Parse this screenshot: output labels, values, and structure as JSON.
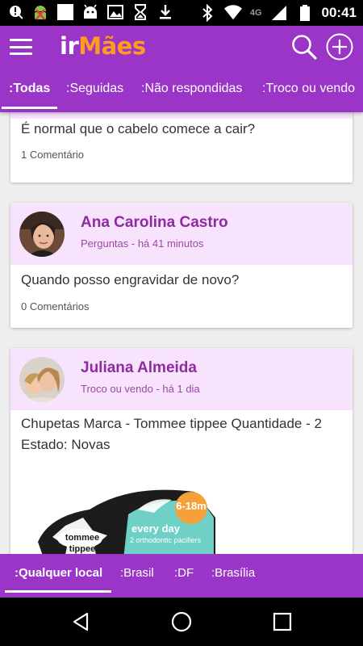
{
  "status_bar": {
    "time": "00:41",
    "network": "4G",
    "left_icons": [
      "alert-icon",
      "android-debug-icon",
      "blank-notification-icon",
      "android-icon",
      "image-icon",
      "hourglass-icon",
      "download-icon"
    ],
    "right_icons": [
      "bluetooth-icon",
      "wifi-icon",
      "signal-icon",
      "battery-icon"
    ]
  },
  "app": {
    "logo_part1": "ir",
    "logo_part2": "Mães",
    "colors": {
      "primary": "#9a35c8",
      "logo_accent": "#ff9d1a",
      "card_header": "#f8e3fd",
      "author": "#8f2aa0"
    }
  },
  "tabs": [
    {
      "label": ":Todas",
      "active": true
    },
    {
      "label": ":Seguidas",
      "active": false
    },
    {
      "label": ":Não respondidas",
      "active": false
    },
    {
      "label": ":Troco ou vendo",
      "active": false
    }
  ],
  "posts": [
    {
      "text": "É normal que o cabelo comece a cair?",
      "comments": "1 Comentário"
    },
    {
      "author": "Ana Carolina Castro",
      "meta": "Perguntas - há 41 minutos",
      "text": "Quando posso engravidar de novo?",
      "comments": "0 Comentários"
    },
    {
      "author": "Juliana Almeida",
      "meta": "Troco ou vendo - há 1 dia",
      "text": "Chupetas Marca - Tommee tippee Quantidade - 2 Estado: Novas",
      "image": {
        "badge": "6-18m",
        "brand": "tommee tippee",
        "line1": "every day",
        "line2": "2 orthodontic pacifiers"
      }
    }
  ],
  "locations": [
    {
      "label": ":Qualquer local",
      "active": true
    },
    {
      "label": ":Brasil",
      "active": false
    },
    {
      "label": ":DF",
      "active": false
    },
    {
      "label": ":Brasília",
      "active": false
    }
  ],
  "nav": [
    "back-icon",
    "home-icon",
    "recents-icon"
  ]
}
